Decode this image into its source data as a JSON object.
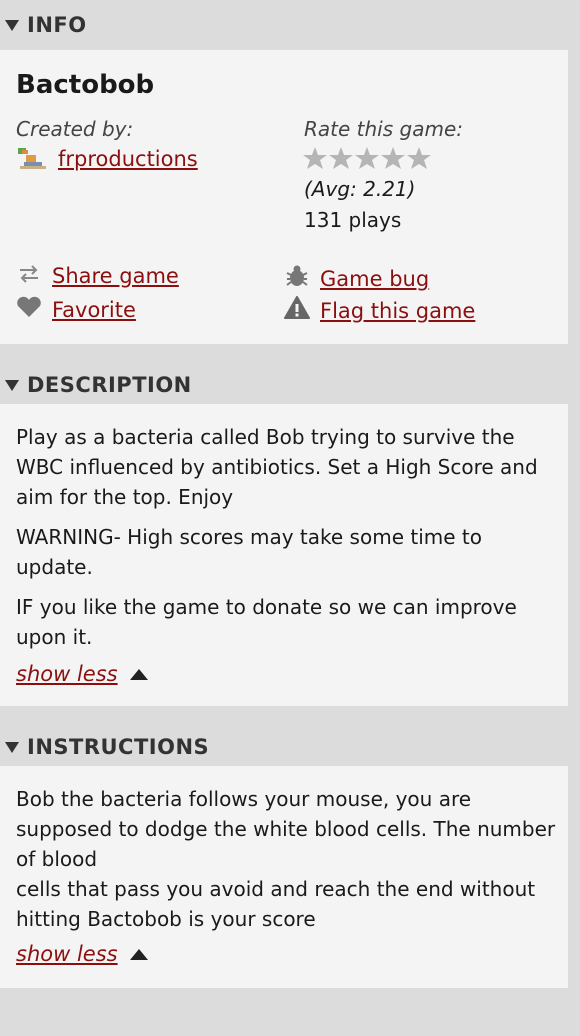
{
  "info": {
    "header": "INFO",
    "title": "Bactobob",
    "created_by_label": "Created by:",
    "creator": "frproductions",
    "rate_label": "Rate this game:",
    "rating_stars": 0,
    "avg": "(Avg: 2.21)",
    "plays": "131 plays",
    "actions": {
      "share": "Share game",
      "bug": "Game bug",
      "favorite": "Favorite",
      "flag": "Flag this game"
    }
  },
  "description": {
    "header": "DESCRIPTION",
    "paragraphs": [
      "Play as a bacteria called Bob trying to survive the WBC influenced by antibiotics. Set a High Score and aim for the top. Enjoy",
      "WARNING- High scores may take some time to update.",
      "IF you like the game to donate so we can improve upon it."
    ],
    "show_less": "show less"
  },
  "instructions": {
    "header": "INSTRUCTIONS",
    "line1": "Bob the bacteria follows your mouse, you are supposed to dodge the white blood cells. The number of blood",
    "line2": "cells that pass you avoid and reach the end without hitting Bactobob is your score",
    "show_less": "show less"
  },
  "colors": {
    "link": "#8b0f0f",
    "background": "#dcdcdc",
    "panel": "#f4f4f4"
  }
}
